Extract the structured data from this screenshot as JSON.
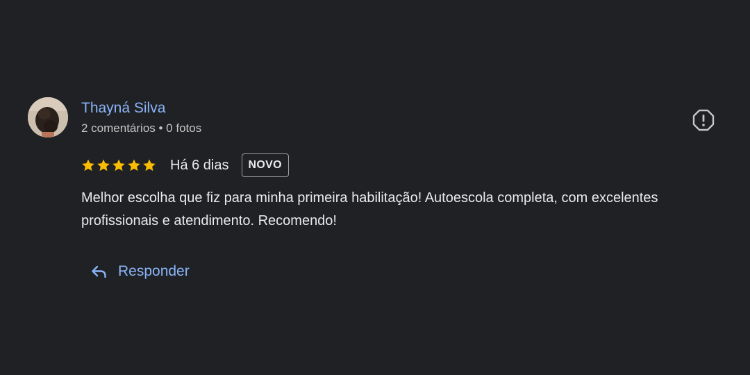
{
  "review": {
    "author": {
      "name": "Thayná Silva",
      "meta": "2 comentários • 0 fotos"
    },
    "rating": 5,
    "rating_max": 5,
    "date": "Há 6 dias",
    "badge": "NOVO",
    "text": "Melhor escolha que fiz para minha primeira habilitação! Autoescola completa, com excelentes profissionais e atendimento. Recomendo!",
    "reply_label": "Responder",
    "icons": {
      "flag": "report-flag-icon",
      "reply": "reply-arrow-icon",
      "star": "star-icon"
    }
  },
  "colors": {
    "background": "#202124",
    "link": "#8ab4f8",
    "star": "#fbbc04",
    "text": "#e8eaed",
    "secondary_text": "#c4c7c5"
  }
}
